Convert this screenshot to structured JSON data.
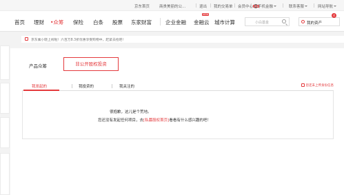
{
  "topbar": {
    "links": [
      "京东首页",
      "商贵美丽的公...",
      "退出",
      "我的交易单",
      "会员中心",
      "手机金融",
      "联系客服",
      "网站导航"
    ],
    "new_badge": "new"
  },
  "nav": {
    "items": [
      "首页",
      "理财",
      "众筹",
      "保险",
      "白条",
      "股票",
      "东家财富",
      "企业金融",
      "金融云",
      "城市计算"
    ],
    "active_index": 2,
    "hot_label": "NEW",
    "search_placeholder": "小白基金",
    "my_assets": "我的资产",
    "asset_count": "4"
  },
  "notice": {
    "text": "京东乘小晓上线啦！六百万8.3折优惠享受购物中，赶紧去抢吧！"
  },
  "product_row": {
    "label": "产品众筹",
    "button": "非公开股权投资"
  },
  "tabs": {
    "items": [
      "我发起的",
      "我投资的",
      "我关注的"
    ],
    "active_index": 0,
    "pending_text": "您还未上传身份信息"
  },
  "empty_state": {
    "line1": "很抱歉，这儿是个荒地。",
    "line2_prefix": "您还没有发起任何项目，去",
    "line2_link": "[私募股权首页]",
    "line2_suffix": "看看有什么感兴趣的吧！"
  },
  "colors": {
    "accent": "#e4393c",
    "background": "#f3f3f3"
  }
}
